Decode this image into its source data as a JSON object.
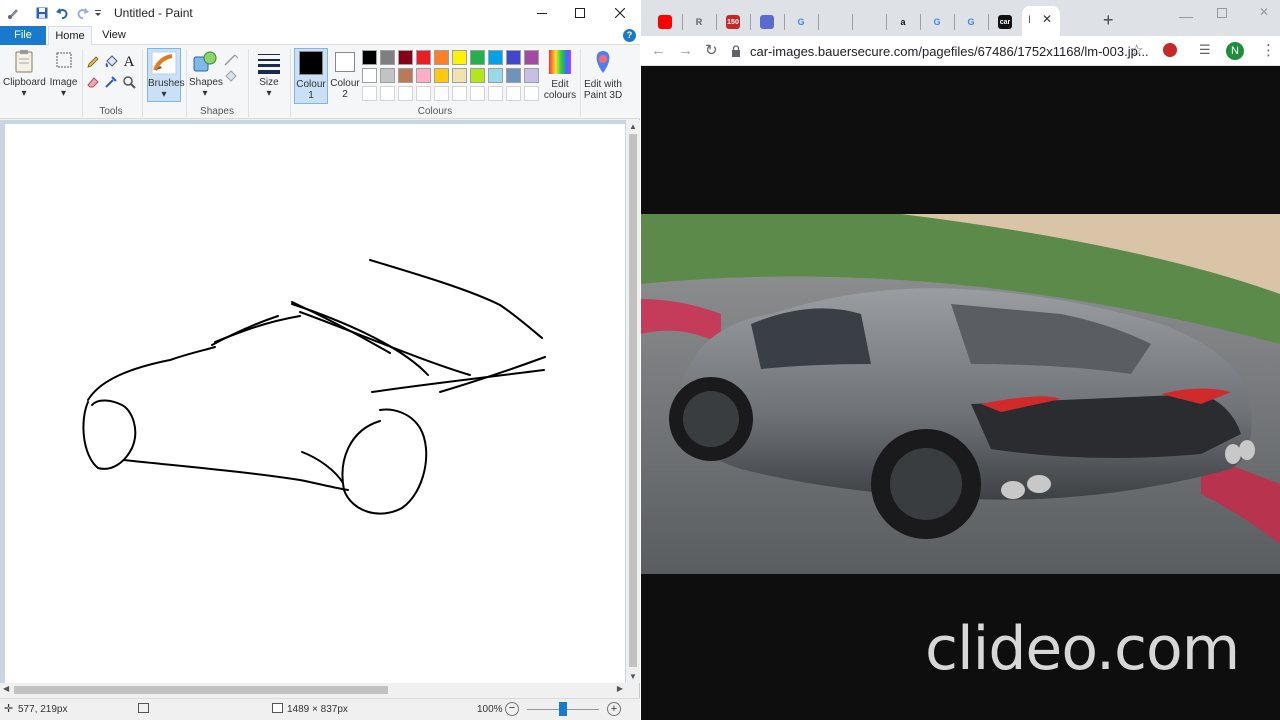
{
  "paint": {
    "title": "Untitled - Paint",
    "tabs": {
      "file": "File",
      "home": "Home",
      "view": "View"
    },
    "help": "?",
    "ribbon": {
      "clipboard": "Clipboard",
      "image": "Image",
      "tools_group": "Tools",
      "brushes": "Brushes",
      "shapes_btn": "Shapes",
      "shapes_group": "Shapes",
      "size": "Size",
      "colour1": "Colour 1",
      "colour2": "Colour 2",
      "colours_group": "Colours",
      "edit_colours": "Edit colours",
      "paint3d": "Edit with Paint 3D"
    },
    "palette_row1": [
      "#000000",
      "#7f7f7f",
      "#880015",
      "#ed1c24",
      "#ff7f27",
      "#fff200",
      "#22b14c",
      "#00a2e8",
      "#3f48cc",
      "#a349a4"
    ],
    "palette_row2": [
      "#ffffff",
      "#c3c3c3",
      "#b97a57",
      "#ffaec9",
      "#ffc90e",
      "#efe4b0",
      "#b5e61d",
      "#99d9ea",
      "#7092be",
      "#c8bfe7"
    ],
    "status": {
      "cursor_pos": "577, 219px",
      "canvas_size": "1489 × 837px",
      "zoom": "100%",
      "zoom_level": 0.5
    }
  },
  "browser": {
    "url": "car-images.bauersecure.com/pagefiles/67486/1752x1168/lm-003.jp...",
    "profile_initial": "N",
    "watermark": "clideo.com",
    "tabs": [
      {
        "icon": "youtube-icon",
        "text": ""
      },
      {
        "icon": "tab-r-icon",
        "text": "R"
      },
      {
        "icon": "tab-150-icon",
        "text": "150"
      },
      {
        "icon": "tab-app-icon",
        "text": ""
      },
      {
        "icon": "google-icon",
        "text": "G"
      },
      {
        "icon": "pin-icon",
        "text": ""
      },
      {
        "icon": "tab-wavy-icon",
        "text": ""
      },
      {
        "icon": "amazon-icon",
        "text": "a"
      },
      {
        "icon": "google-icon",
        "text": "G"
      },
      {
        "icon": "google-icon",
        "text": "G"
      },
      {
        "icon": "car-icon",
        "text": "car"
      }
    ]
  }
}
